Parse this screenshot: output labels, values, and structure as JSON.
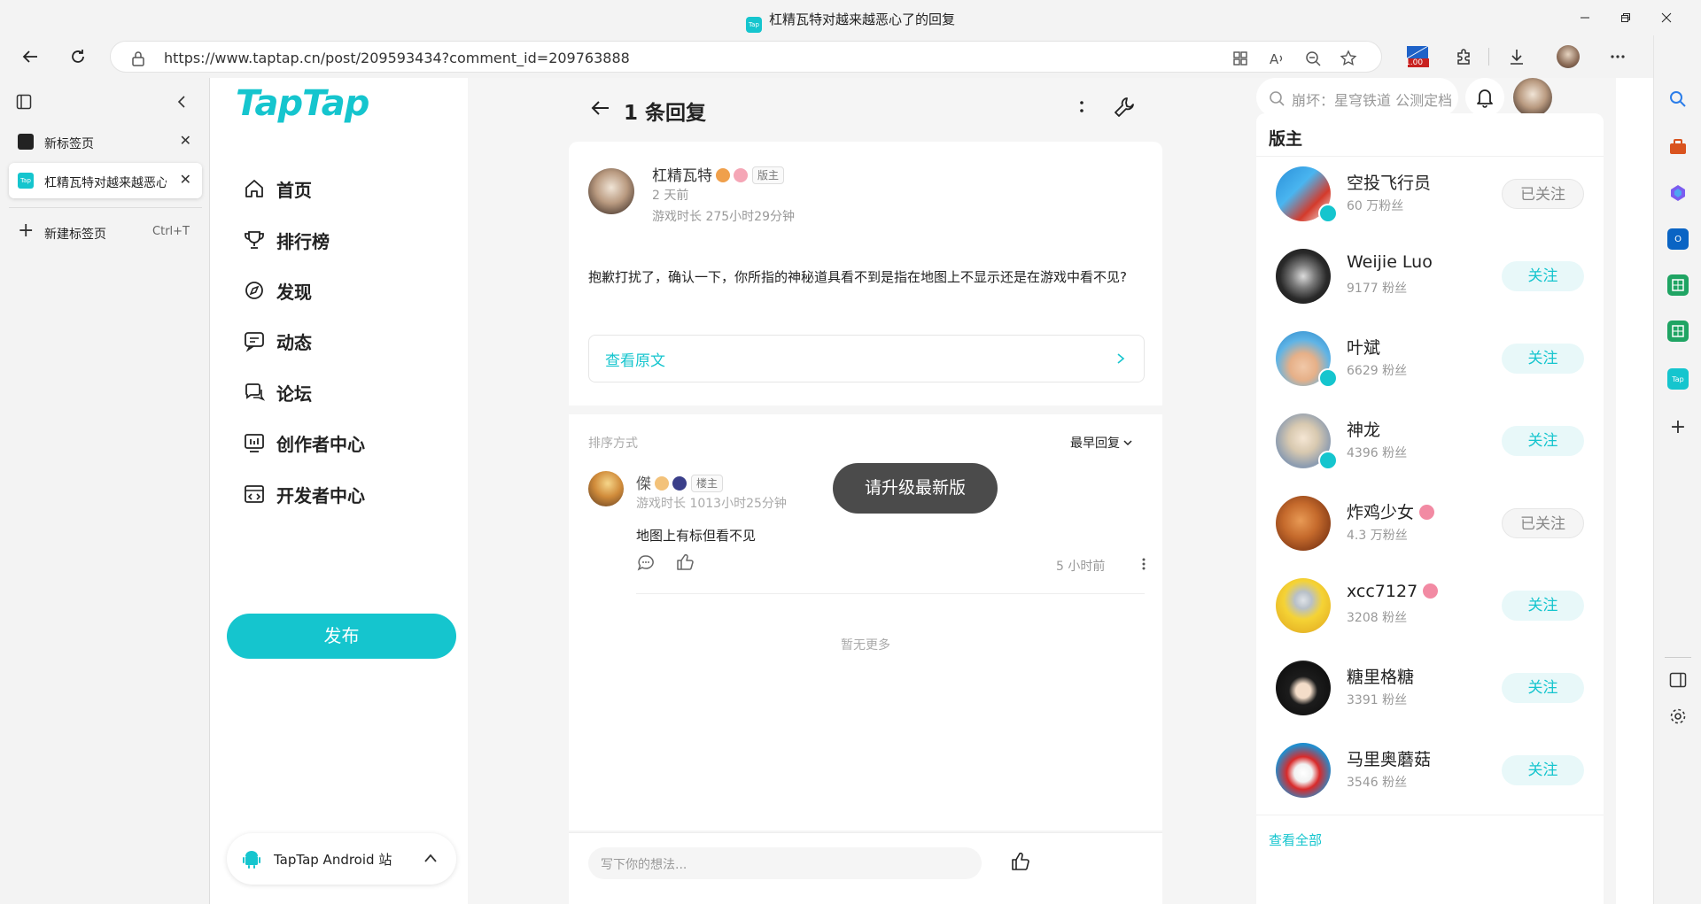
{
  "browser": {
    "window_title": "杠精瓦特对越来越恶心了的回复",
    "url": "https://www.taptap.cn/post/209593434?comment_id=209763888",
    "extension_badge": "1.00",
    "favicon_text": "Tap"
  },
  "tabs": {
    "items": [
      {
        "label": "新标签页"
      },
      {
        "label": "杠精瓦特对越来越恶心了的回复"
      }
    ],
    "new_tab_label": "新建标签页",
    "new_tab_shortcut": "Ctrl+T"
  },
  "site": {
    "logo": "TapTap",
    "nav": [
      {
        "label": "首页",
        "icon": "home-icon"
      },
      {
        "label": "排行榜",
        "icon": "trophy-icon"
      },
      {
        "label": "发现",
        "icon": "compass-icon"
      },
      {
        "label": "动态",
        "icon": "chat-icon"
      },
      {
        "label": "论坛",
        "icon": "forum-icon"
      },
      {
        "label": "创作者中心",
        "icon": "creator-icon"
      },
      {
        "label": "开发者中心",
        "icon": "developer-icon"
      }
    ],
    "publish_label": "发布",
    "android_label": "TapTap Android 站",
    "search_placeholder": "崩坏：星穹铁道 公测定档",
    "accent_color": "#15c5ce"
  },
  "thread": {
    "header_title": "1 条回复",
    "original": {
      "author": "杠精瓦特",
      "tag": "版主",
      "time": "2 天前",
      "playtime": "游戏时长 275小时29分钟",
      "content": "抱歉打扰了，确认一下，你所指的神秘道具看不到是指在地图上不显示还是在游戏中看不见?",
      "view_original_label": "查看原文"
    },
    "sort_label": "排序方式",
    "sort_value": "最早回复",
    "reply": {
      "author": "傑",
      "tag": "楼主",
      "playtime": "游戏时长 1013小时25分钟",
      "content": "地图上有标但看不见",
      "time": "5 小时前"
    },
    "toast": "请升级最新版",
    "no_more": "暂无更多",
    "comment_placeholder": "写下你的想法..."
  },
  "moderators": {
    "title": "版主",
    "items": [
      {
        "name": "空投飞行员",
        "followers": "60 万粉丝",
        "button": "已关注",
        "followed": true,
        "verified": true,
        "badge": false
      },
      {
        "name": "Weijie Luo",
        "followers": "9177 粉丝",
        "button": "关注",
        "followed": false,
        "verified": false,
        "badge": false
      },
      {
        "name": "叶斌",
        "followers": "6629 粉丝",
        "button": "关注",
        "followed": false,
        "verified": true,
        "badge": false
      },
      {
        "name": "神龙",
        "followers": "4396 粉丝",
        "button": "关注",
        "followed": false,
        "verified": true,
        "badge": false
      },
      {
        "name": "炸鸡少女",
        "followers": "4.3 万粉丝",
        "button": "已关注",
        "followed": true,
        "verified": false,
        "badge": true
      },
      {
        "name": "xcc7127",
        "followers": "3208 粉丝",
        "button": "关注",
        "followed": false,
        "verified": false,
        "badge": true
      },
      {
        "name": "糖里格糖",
        "followers": "3391 粉丝",
        "button": "关注",
        "followed": false,
        "verified": false,
        "badge": false
      },
      {
        "name": "马里奥蘑菇",
        "followers": "3546 粉丝",
        "button": "关注",
        "followed": false,
        "verified": false,
        "badge": false
      }
    ],
    "view_all": "查看全部"
  }
}
